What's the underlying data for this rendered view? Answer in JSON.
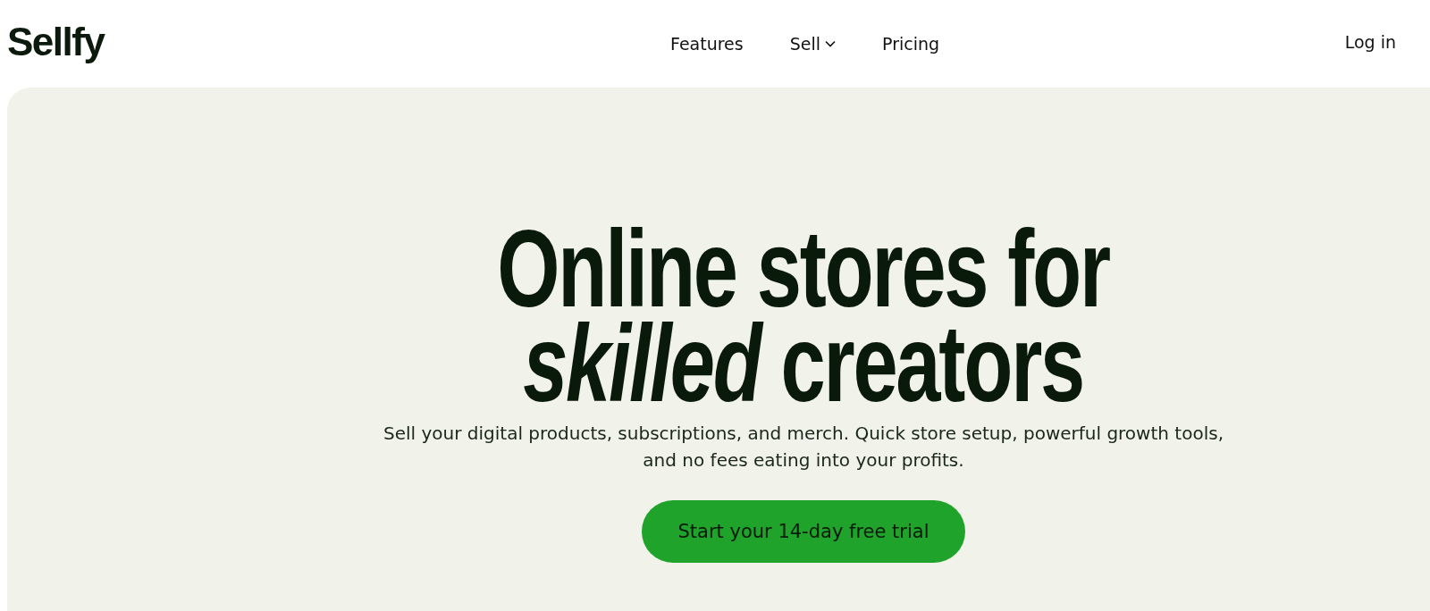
{
  "header": {
    "logo": "Sellfy",
    "nav": [
      {
        "label": "Features",
        "kind": "link"
      },
      {
        "label": "Sell",
        "kind": "dropdown"
      },
      {
        "label": "Pricing",
        "kind": "link"
      }
    ],
    "login": "Log in"
  },
  "hero": {
    "headline": [
      "Online stores for",
      "*skilled* creators"
    ],
    "subtitle": "Sell your digital products, subscriptions, and merch. Quick store setup, powerful growth tools, and no fees eating into your profits.",
    "cta": "Start your 14-day free trial"
  }
}
